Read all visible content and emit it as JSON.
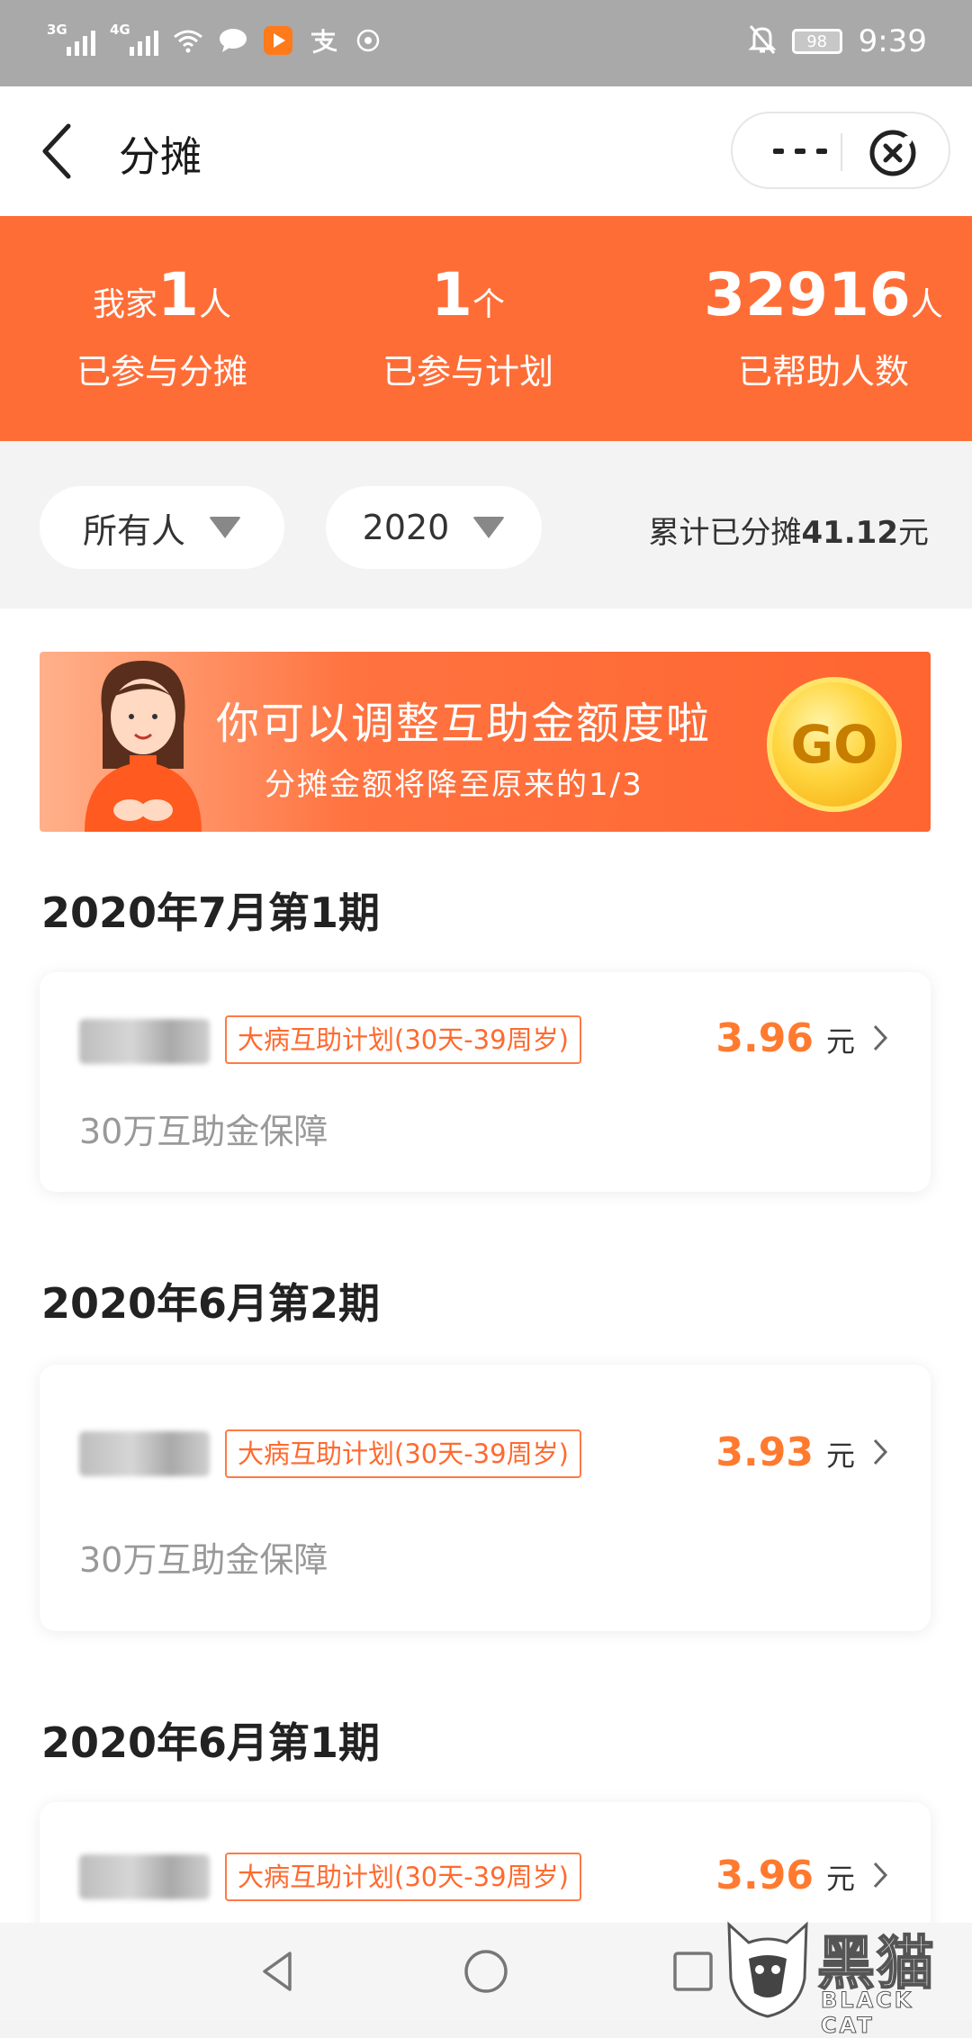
{
  "status_bar": {
    "signal1_label": "3G",
    "signal2_label": "4G",
    "battery": "98",
    "time": "9:39"
  },
  "header": {
    "title": "分摊"
  },
  "stats": [
    {
      "prefix": "我家",
      "value": "1",
      "unit": "人",
      "label": "已参与分摊"
    },
    {
      "prefix": "",
      "value": "1",
      "unit": "个",
      "label": "已参与计划"
    },
    {
      "prefix": "",
      "value": "32916",
      "unit": "人",
      "label": "已帮助人数"
    }
  ],
  "filters": {
    "person": "所有人",
    "year": "2020",
    "total_prefix": "累计已分摊",
    "total_amount": "41.12",
    "total_unit": "元"
  },
  "banner": {
    "line1": "你可以调整互助金额度啦",
    "line2": "分摊金额将降至原来的1/3",
    "button": "GO"
  },
  "periods": [
    {
      "title": "2020年7月第1期",
      "tag": "大病互助计划(30天-39周岁)",
      "amount": "3.96",
      "unit": "元",
      "desc": "30万互助金保障"
    },
    {
      "title": "2020年6月第2期",
      "tag": "大病互助计划(30天-39周岁)",
      "amount": "3.93",
      "unit": "元",
      "desc": "30万互助金保障"
    },
    {
      "title": "2020年6月第1期",
      "tag": "大病互助计划(30天-39周岁)",
      "amount": "3.96",
      "unit": "元",
      "desc": ""
    }
  ],
  "watermark": {
    "cn": "黑猫",
    "en": "BLACK CAT"
  }
}
